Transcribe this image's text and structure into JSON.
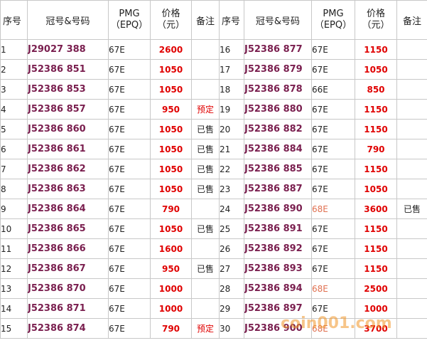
{
  "headers": {
    "no": "序号",
    "serial": "冠号&号码",
    "grade_line1": "PMG",
    "grade_line2": "（EPQ）",
    "price_line1": "价格",
    "price_line2": "（元）",
    "note": "备注"
  },
  "colors": {
    "serial": "#7a1f4f",
    "price": "#e00000",
    "grade_alt": "#e07050",
    "watermark": "#f09628"
  },
  "watermark": "coin001.com",
  "left": [
    {
      "no": "1",
      "serial": "J29027 388",
      "grade": "67E",
      "price": "2600",
      "note": ""
    },
    {
      "no": "2",
      "serial": "J52386 851",
      "grade": "67E",
      "price": "1050",
      "note": ""
    },
    {
      "no": "3",
      "serial": "J52386 853",
      "grade": "67E",
      "price": "1050",
      "note": ""
    },
    {
      "no": "4",
      "serial": "J52386 857",
      "grade": "67E",
      "price": "950",
      "note": "预定"
    },
    {
      "no": "5",
      "serial": "J52386 860",
      "grade": "67E",
      "price": "1050",
      "note": "已售"
    },
    {
      "no": "6",
      "serial": "J52386 861",
      "grade": "67E",
      "price": "1050",
      "note": "已售"
    },
    {
      "no": "7",
      "serial": "J52386 862",
      "grade": "67E",
      "price": "1050",
      "note": "已售"
    },
    {
      "no": "8",
      "serial": "J52386 863",
      "grade": "67E",
      "price": "1050",
      "note": "已售"
    },
    {
      "no": "9",
      "serial": "J52386 864",
      "grade": "67E",
      "price": "790",
      "note": ""
    },
    {
      "no": "10",
      "serial": "J52386 865",
      "grade": "67E",
      "price": "1050",
      "note": "已售"
    },
    {
      "no": "11",
      "serial": "J52386 866",
      "grade": "67E",
      "price": "1600",
      "note": ""
    },
    {
      "no": "12",
      "serial": "J52386 867",
      "grade": "67E",
      "price": "950",
      "note": "已售"
    },
    {
      "no": "13",
      "serial": "J52386 870",
      "grade": "67E",
      "price": "1000",
      "note": ""
    },
    {
      "no": "14",
      "serial": "J52386 871",
      "grade": "67E",
      "price": "1000",
      "note": ""
    },
    {
      "no": "15",
      "serial": "J52386 874",
      "grade": "67E",
      "price": "790",
      "note": "预定"
    }
  ],
  "right": [
    {
      "no": "16",
      "serial": "J52386 877",
      "grade": "67E",
      "price": "1150",
      "note": ""
    },
    {
      "no": "17",
      "serial": "J52386 879",
      "grade": "67E",
      "price": "1050",
      "note": ""
    },
    {
      "no": "18",
      "serial": "J52386 878",
      "grade": "66E",
      "price": "850",
      "note": ""
    },
    {
      "no": "19",
      "serial": "J52386 880",
      "grade": "67E",
      "price": "1150",
      "note": ""
    },
    {
      "no": "20",
      "serial": "J52386 882",
      "grade": "67E",
      "price": "1150",
      "note": ""
    },
    {
      "no": "21",
      "serial": "J52386 884",
      "grade": "67E",
      "price": "790",
      "note": ""
    },
    {
      "no": "22",
      "serial": "J52386 885",
      "grade": "67E",
      "price": "1150",
      "note": ""
    },
    {
      "no": "23",
      "serial": "J52386 887",
      "grade": "67E",
      "price": "1050",
      "note": ""
    },
    {
      "no": "24",
      "serial": "J52386 890",
      "grade": "68E",
      "price": "3600",
      "note": "已售"
    },
    {
      "no": "25",
      "serial": "J52386 891",
      "grade": "67E",
      "price": "1150",
      "note": ""
    },
    {
      "no": "26",
      "serial": "J52386 892",
      "grade": "67E",
      "price": "1150",
      "note": ""
    },
    {
      "no": "27",
      "serial": "J52386 893",
      "grade": "67E",
      "price": "1150",
      "note": ""
    },
    {
      "no": "28",
      "serial": "J52386 894",
      "grade": "68E",
      "price": "2500",
      "note": ""
    },
    {
      "no": "29",
      "serial": "J52386 897",
      "grade": "67E",
      "price": "1000",
      "note": ""
    },
    {
      "no": "30",
      "serial": "J52386 900",
      "grade": "68E",
      "price": "3700",
      "note": ""
    }
  ]
}
